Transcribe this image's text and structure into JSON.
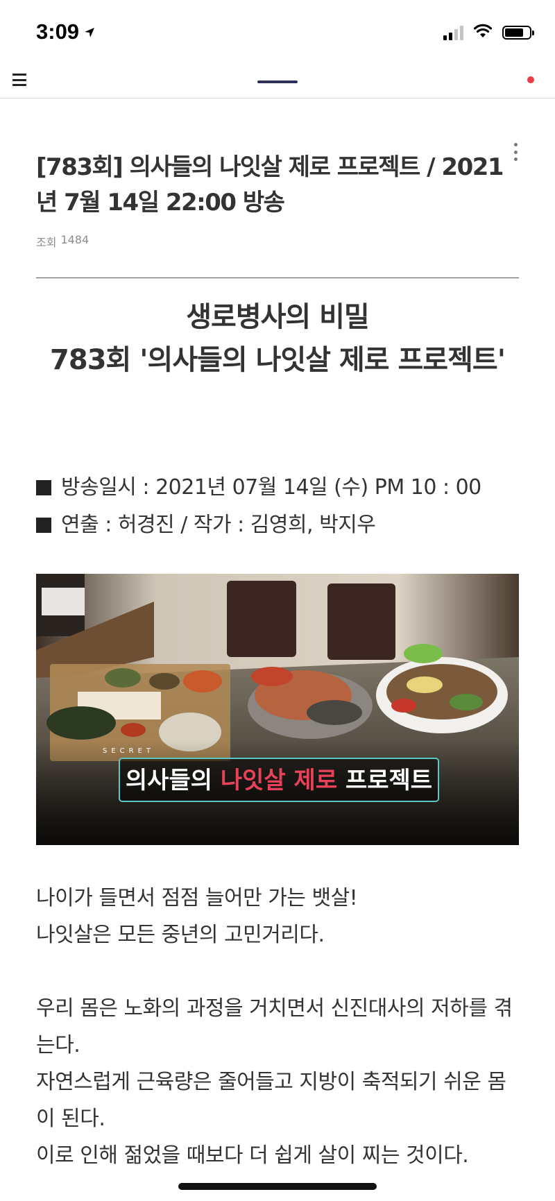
{
  "status_bar": {
    "time": "3:09",
    "location_icon": "location-arrow-icon",
    "signal_icon": "cellular-signal-icon",
    "wifi_icon": "wifi-icon",
    "battery_icon": "battery-icon",
    "battery_level": 0.75
  },
  "nav": {
    "menu_icon": "hamburger-menu-icon",
    "notification_color": "#ee3b48"
  },
  "post": {
    "title": "[783회] 의사들의 나잇살 제로 프로젝트 / 2021년 7월 14일 22:00 방송",
    "views_label": "조회",
    "views_count": "1484",
    "more_icon": "more-vertical-icon"
  },
  "content": {
    "heading_line1": "생로병사의 비밀",
    "heading_line2": "783회 '의사들의 나잇살 제로 프로젝트'",
    "info": [
      "방송일시 : 2021년 07월 14일 (수) PM 10 : 00",
      "연출 : 허경진 / 작가 : 김영희, 박지우"
    ],
    "image": {
      "kicker": "SECRET",
      "caption_part1": "의사들의",
      "caption_part2": "나잇살 제로",
      "caption_part3": "프로젝트",
      "caption_accent": "#e8425a",
      "caption_border": "#5cc8c6"
    },
    "paragraphs": [
      "나이가 들면서 점점 늘어만 가는 뱃살!",
      "나잇살은 모든 중년의 고민거리다.",
      "",
      "우리 몸은 노화의 과정을 거치면서 신진대사의 저하를 겪는다.",
      "자연스럽게 근육량은 줄어들고 지방이 축적되기 쉬운 몸이 된다.",
      "이로 인해 젊었을 때보다 더 쉽게 살이 찌는 것이다."
    ]
  }
}
